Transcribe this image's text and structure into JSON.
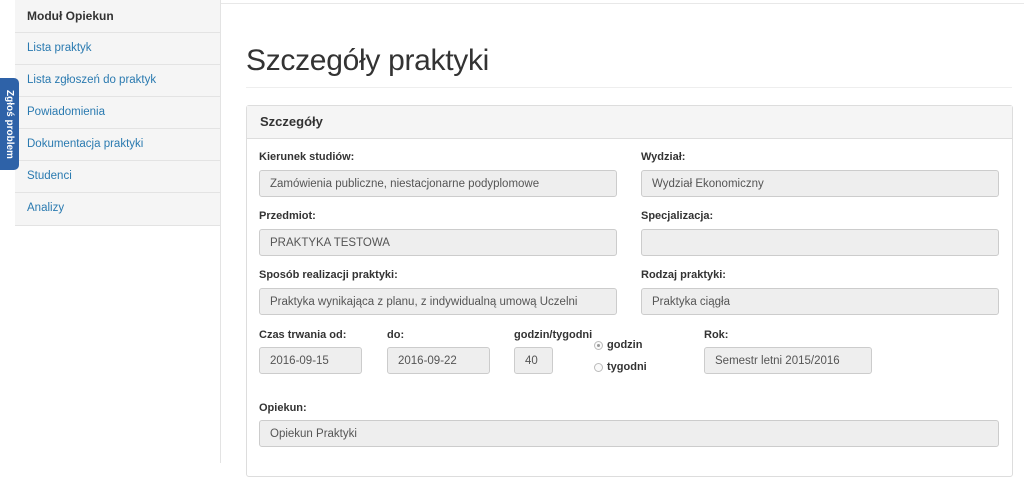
{
  "sidebar": {
    "title": "Moduł Opiekun",
    "items": [
      {
        "label": "Lista praktyk"
      },
      {
        "label": "Lista zgłoszeń do praktyk"
      },
      {
        "label": "Powiadomienia"
      },
      {
        "label": "Dokumentacja praktyki"
      },
      {
        "label": "Studenci"
      },
      {
        "label": "Analizy"
      }
    ]
  },
  "feedback_tab": {
    "label": "Zgłoś problem"
  },
  "page": {
    "title": "Szczegóły praktyki"
  },
  "panel": {
    "heading": "Szczegóły",
    "fields": {
      "kierunek": {
        "label": "Kierunek studiów:",
        "value": "Zamówienia publiczne, niestacjonarne podyplomowe"
      },
      "wydzial": {
        "label": "Wydział:",
        "value": "Wydział Ekonomiczny"
      },
      "przedmiot": {
        "label": "Przedmiot:",
        "value": "PRAKTYKA TESTOWA"
      },
      "specjalizacja": {
        "label": "Specjalizacja:",
        "value": ""
      },
      "sposob": {
        "label": "Sposób realizacji praktyki:",
        "value": "Praktyka wynikająca z planu, z indywidualną umową Uczelni"
      },
      "rodzaj": {
        "label": "Rodzaj praktyki:",
        "value": "Praktyka ciągła"
      },
      "czas_od": {
        "label": "Czas trwania od:",
        "value": "2016-09-15"
      },
      "czas_do": {
        "label": "do:",
        "value": "2016-09-22"
      },
      "godzin_tyg": {
        "label": "godzin/tygodni",
        "value": "40"
      },
      "unit_options": [
        {
          "label": "godzin",
          "selected": true
        },
        {
          "label": "tygodni",
          "selected": false
        }
      ],
      "rok": {
        "label": "Rok:",
        "value": "Semestr letni 2015/2016"
      },
      "opiekun": {
        "label": "Opiekun:",
        "value": "Opiekun Praktyki"
      }
    }
  },
  "colors": {
    "link": "#2a7ab0",
    "feedback_tab": "#2e62a8",
    "field_bg": "#eeeeee",
    "panel_heading_bg": "#f5f5f5"
  }
}
